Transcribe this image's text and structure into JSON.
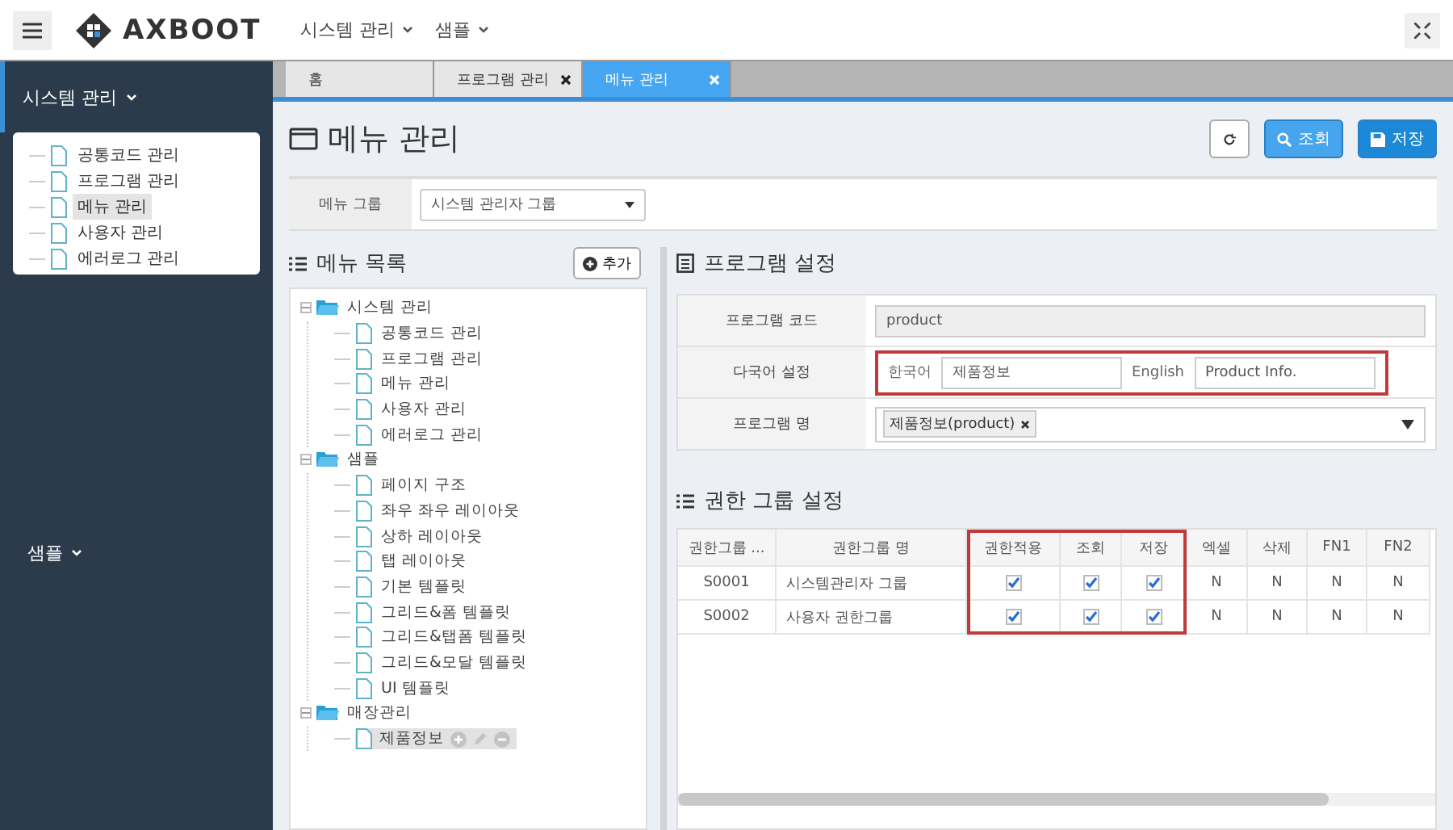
{
  "header": {
    "logo": "AXBOOT",
    "menus": [
      {
        "label": "시스템 관리"
      },
      {
        "label": "샘플"
      }
    ]
  },
  "sidebar": {
    "sections": [
      {
        "label": "시스템 관리",
        "expanded": true,
        "items": [
          {
            "label": "공통코드 관리",
            "selected": false
          },
          {
            "label": "프로그램 관리",
            "selected": false
          },
          {
            "label": "메뉴 관리",
            "selected": true
          },
          {
            "label": "사용자 관리",
            "selected": false
          },
          {
            "label": "에러로그 관리",
            "selected": false
          }
        ]
      },
      {
        "label": "샘플",
        "expanded": false
      }
    ]
  },
  "tabs": [
    {
      "label": "홈",
      "selected": false,
      "closable": false
    },
    {
      "label": "프로그램 관리",
      "selected": false,
      "closable": true
    },
    {
      "label": "메뉴 관리",
      "selected": true,
      "closable": true
    }
  ],
  "page": {
    "title": "메뉴 관리",
    "buttons": [
      {
        "kind": "refresh"
      },
      {
        "kind": "search",
        "label": "조회"
      },
      {
        "kind": "save",
        "label": "저장"
      }
    ]
  },
  "search_bar": {
    "label": "메뉴 그룹",
    "value": "시스템 관리자 그룹"
  },
  "menu_list": {
    "title": "메뉴 목록",
    "add_button": "추가",
    "tree": [
      {
        "label": "시스템 관리",
        "kind": "folder",
        "expanded": true,
        "selected": false,
        "children": [
          {
            "label": "공통코드 관리",
            "kind": "file",
            "selected": false
          },
          {
            "label": "프로그램 관리",
            "kind": "file",
            "selected": false
          },
          {
            "label": "메뉴 관리",
            "kind": "file",
            "selected": false
          },
          {
            "label": "사용자 관리",
            "kind": "file",
            "selected": false
          },
          {
            "label": "에러로그 관리",
            "kind": "file",
            "selected": false
          }
        ]
      },
      {
        "label": "샘플",
        "kind": "folder",
        "expanded": true,
        "selected": false,
        "children": [
          {
            "label": "페이지 구조",
            "kind": "file",
            "selected": false
          },
          {
            "label": "좌우 좌우 레이아웃",
            "kind": "file",
            "selected": false
          },
          {
            "label": "상하 레이아웃",
            "kind": "file",
            "selected": false
          },
          {
            "label": "탭 레이아웃",
            "kind": "file",
            "selected": false
          },
          {
            "label": "기본 템플릿",
            "kind": "file",
            "selected": false
          },
          {
            "label": "그리드&폼 템플릿",
            "kind": "file",
            "selected": false
          },
          {
            "label": "그리드&탭폼 템플릿",
            "kind": "file",
            "selected": false
          },
          {
            "label": "그리드&모달 템플릿",
            "kind": "file",
            "selected": false
          },
          {
            "label": "UI 템플릿",
            "kind": "file",
            "selected": false
          }
        ]
      },
      {
        "label": "매장관리",
        "kind": "folder",
        "expanded": true,
        "selected": false,
        "children": [
          {
            "label": "제품정보",
            "kind": "file",
            "selected": true
          }
        ]
      }
    ]
  },
  "program_settings": {
    "title": "프로그램 설정",
    "code_label": "프로그램 코드",
    "code_value": "product",
    "lang_label": "다국어 설정",
    "lang_highlighted": true,
    "korean_label": "한국어",
    "korean_value": "제품정보",
    "english_label": "English",
    "english_value": "Product Info.",
    "name_label": "프로그램 명",
    "name_tag": "제품정보(product)"
  },
  "auth_groups": {
    "title": "권한 그룹 설정",
    "columns": [
      {
        "label": "권한그룹 ...",
        "highlighted": false
      },
      {
        "label": "권한그룹 명",
        "highlighted": false
      },
      {
        "label": "권한적용",
        "highlighted": true
      },
      {
        "label": "조회",
        "highlighted": true
      },
      {
        "label": "저장",
        "highlighted": true
      },
      {
        "label": "엑셀",
        "highlighted": false
      },
      {
        "label": "삭제",
        "highlighted": false
      },
      {
        "label": "FN1",
        "highlighted": false
      },
      {
        "label": "FN2",
        "highlighted": false
      }
    ],
    "rows": [
      {
        "code": "S0001",
        "name": "시스템관리자 그룹",
        "apply": true,
        "read": true,
        "save": true,
        "excel": "N",
        "delete": "N",
        "fn1": "N",
        "fn2": "N"
      },
      {
        "code": "S0002",
        "name": "사용자 권한그룹",
        "apply": true,
        "read": true,
        "save": true,
        "excel": "N",
        "delete": "N",
        "fn1": "N",
        "fn2": "N"
      }
    ]
  }
}
